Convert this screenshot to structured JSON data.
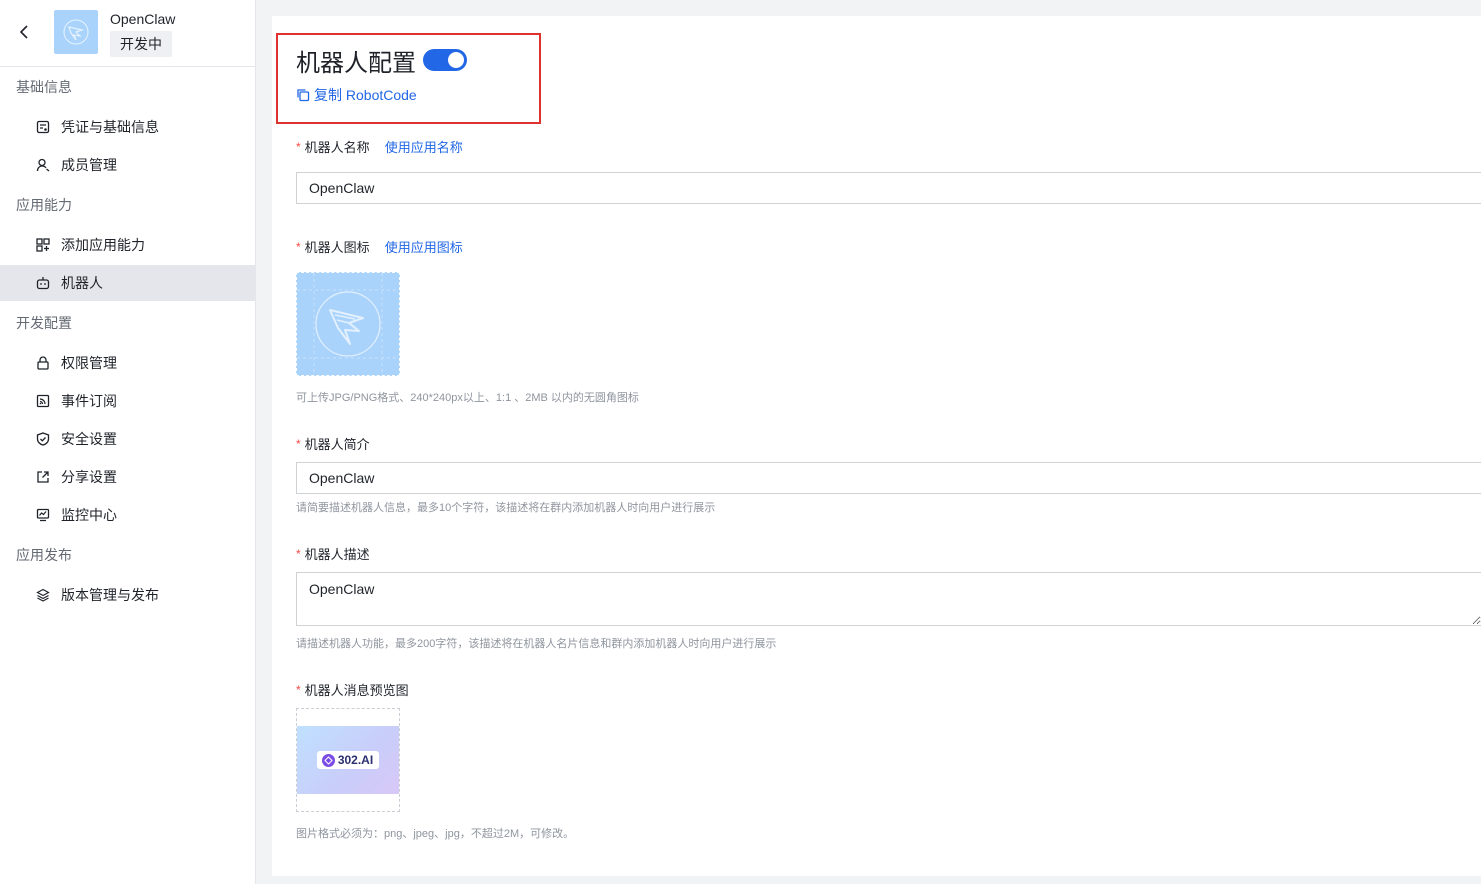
{
  "app": {
    "name": "OpenClaw",
    "status": "开发中"
  },
  "sidebar": {
    "groups": [
      {
        "title": "基础信息",
        "items": [
          {
            "label": "凭证与基础信息",
            "icon": "credential-icon"
          },
          {
            "label": "成员管理",
            "icon": "user-icon"
          }
        ]
      },
      {
        "title": "应用能力",
        "items": [
          {
            "label": "添加应用能力",
            "icon": "apps-icon"
          },
          {
            "label": "机器人",
            "icon": "robot-icon",
            "active": true
          }
        ]
      },
      {
        "title": "开发配置",
        "items": [
          {
            "label": "权限管理",
            "icon": "lock-icon"
          },
          {
            "label": "事件订阅",
            "icon": "rss-icon"
          },
          {
            "label": "安全设置",
            "icon": "shield-icon"
          },
          {
            "label": "分享设置",
            "icon": "share-icon"
          },
          {
            "label": "监控中心",
            "icon": "monitor-icon"
          }
        ]
      },
      {
        "title": "应用发布",
        "items": [
          {
            "label": "版本管理与发布",
            "icon": "layers-icon"
          }
        ]
      }
    ]
  },
  "robot_config": {
    "title": "机器人配置",
    "enabled": true,
    "copy_label": "复制 RobotCode",
    "name_field": {
      "label": "机器人名称",
      "link": "使用应用名称",
      "value": "OpenClaw"
    },
    "icon_field": {
      "label": "机器人图标",
      "link": "使用应用图标",
      "hint": "可上传JPG/PNG格式、240*240px以上、1:1 、2MB 以内的无圆角图标"
    },
    "intro_field": {
      "label": "机器人简介",
      "value": "OpenClaw",
      "hint": "请简要描述机器人信息，最多10个字符，该描述将在群内添加机器人时向用户进行展示"
    },
    "desc_field": {
      "label": "机器人描述",
      "value": "OpenClaw",
      "hint": "请描述机器人功能，最多200字符，该描述将在机器人名片信息和群内添加机器人时向用户进行展示"
    },
    "preview_field": {
      "label": "机器人消息预览图",
      "image_text": "302.AI",
      "hint": "图片格式必须为：png、jpeg、jpg，不超过2M，可修改。"
    }
  },
  "colors": {
    "accent": "#2267e5",
    "highlight_border": "#e03131",
    "required": "#f54a45"
  }
}
